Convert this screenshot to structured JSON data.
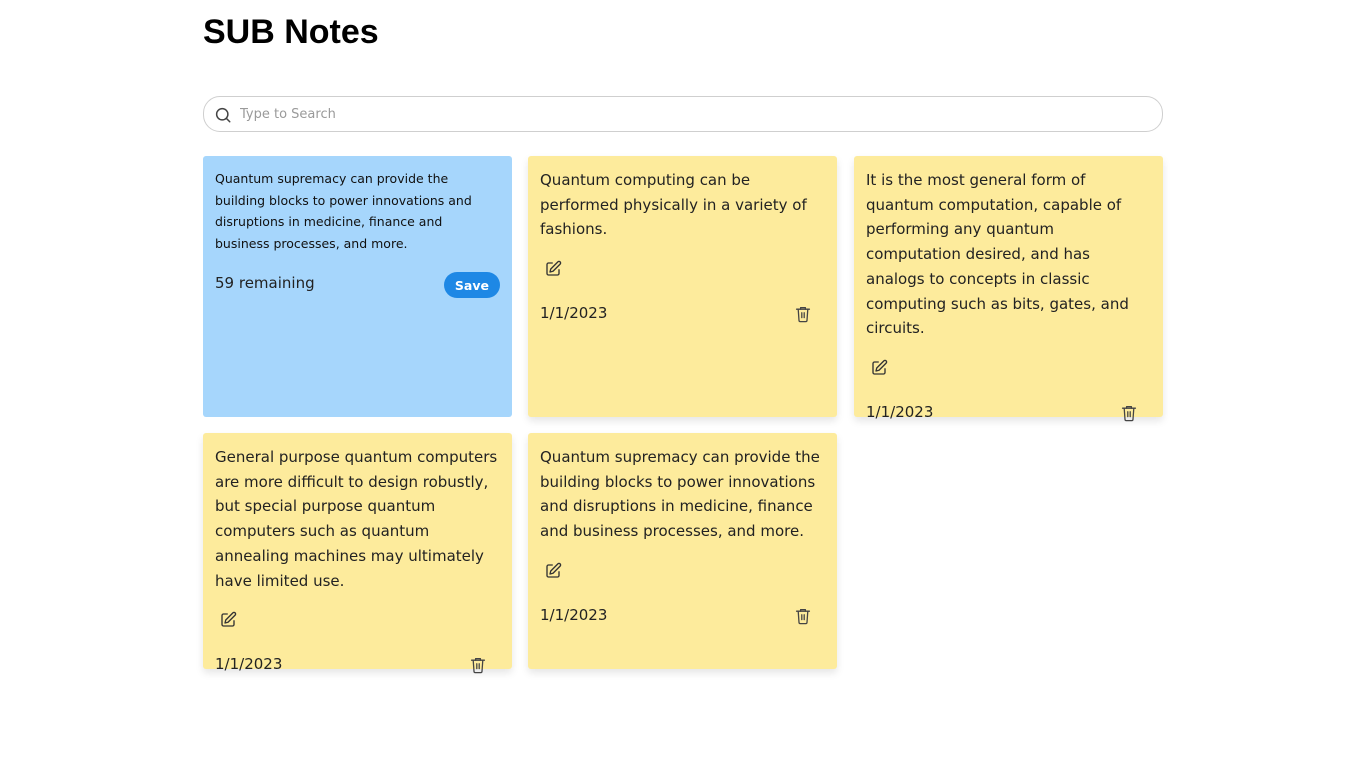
{
  "app": {
    "title": "SUB Notes"
  },
  "search": {
    "placeholder": "Type to Search",
    "value": ""
  },
  "editor": {
    "text": "Quantum supremacy can provide the building blocks to power innovations and disruptions in medicine, finance and business processes, and more.",
    "remaining_label": "59 remaining",
    "save_label": "Save"
  },
  "notes": [
    {
      "text": "Quantum computing can be performed physically in a variety of fashions.",
      "date": "1/1/2023"
    },
    {
      "text": "It is the most general form of quantum computation, capable of performing any quantum computation desired, and has analogs to concepts in classic computing such as bits, gates, and circuits.",
      "date": "1/1/2023"
    },
    {
      "text": "General purpose quantum computers are more difficult to design robustly, but special purpose quantum computers such as quantum annealing machines may ultimately have limited use.",
      "date": "1/1/2023"
    },
    {
      "text": "Quantum supremacy can provide the building blocks to power innovations and disruptions in medicine, finance and business processes, and more.",
      "date": "1/1/2023"
    }
  ],
  "colors": {
    "note_background": "#fdeb9c",
    "editor_background": "#a6d6fc",
    "save_button": "#1e88e5"
  },
  "icons": {
    "search": "search-icon",
    "edit": "edit-icon",
    "delete": "trash-icon"
  }
}
